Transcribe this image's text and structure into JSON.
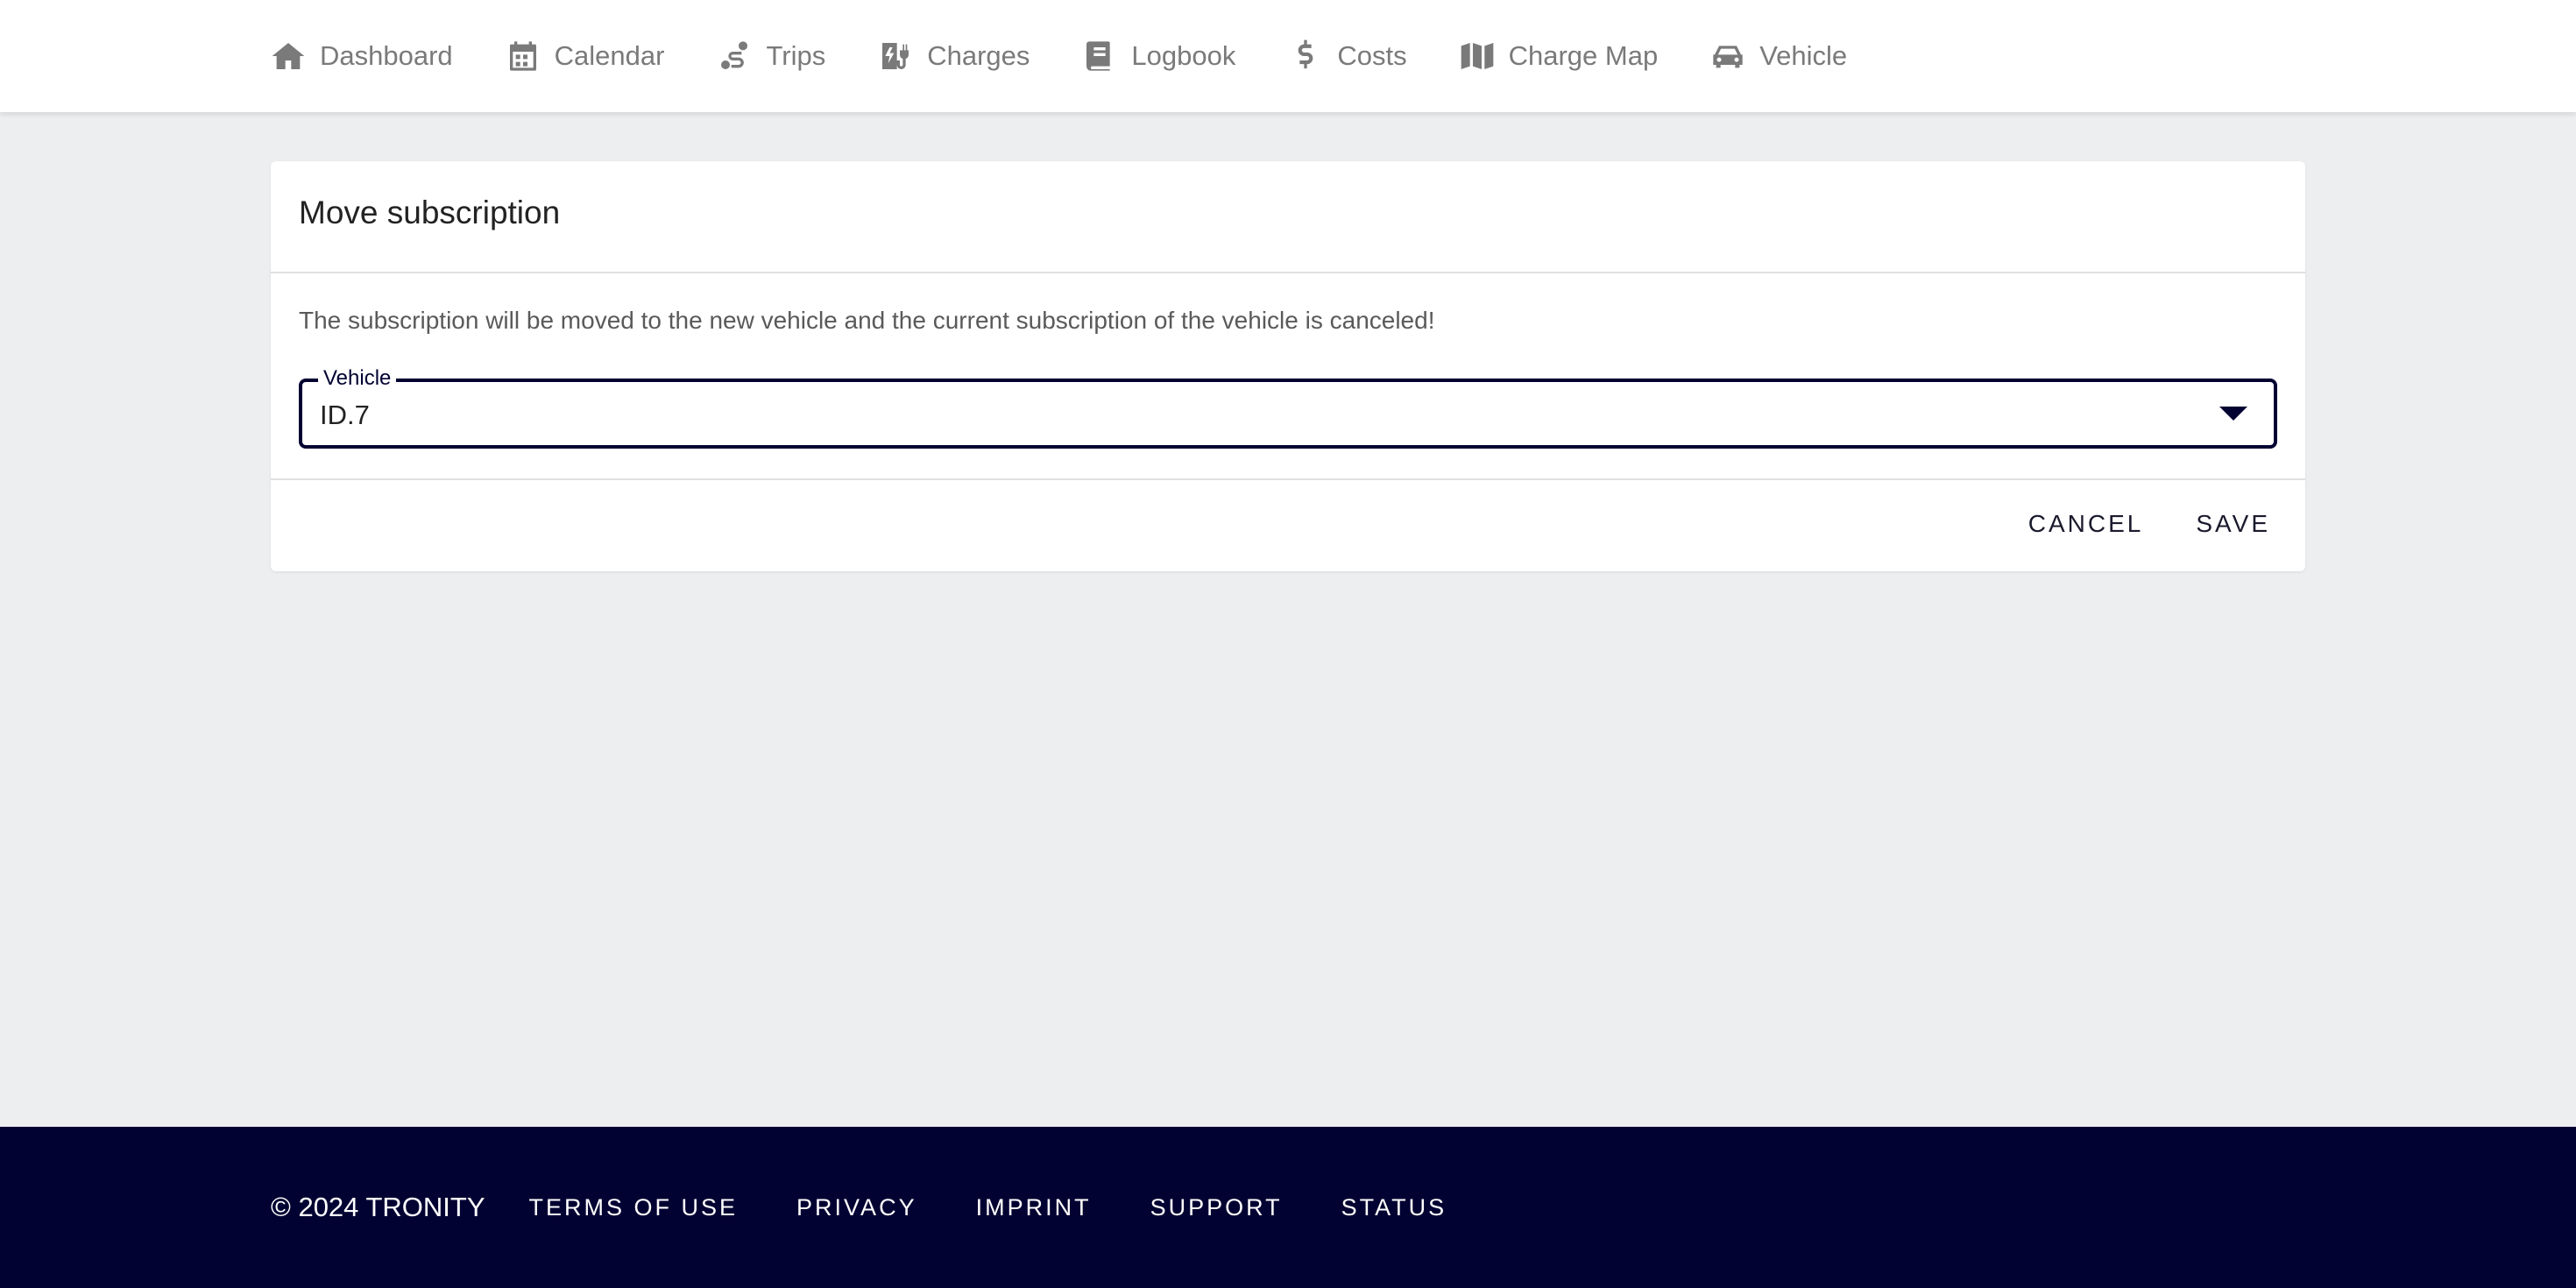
{
  "nav": {
    "items": [
      {
        "label": "Dashboard",
        "icon": "home-icon"
      },
      {
        "label": "Calendar",
        "icon": "calendar-icon"
      },
      {
        "label": "Trips",
        "icon": "route-icon"
      },
      {
        "label": "Charges",
        "icon": "charging-station-icon"
      },
      {
        "label": "Logbook",
        "icon": "book-icon"
      },
      {
        "label": "Costs",
        "icon": "dollar-icon"
      },
      {
        "label": "Charge Map",
        "icon": "map-icon"
      },
      {
        "label": "Vehicle",
        "icon": "car-icon"
      }
    ]
  },
  "dialog": {
    "title": "Move subscription",
    "description": "The subscription will be moved to the new vehicle and the current subscription of the vehicle is canceled!",
    "vehicle_select": {
      "label": "Vehicle",
      "value": "ID.7"
    },
    "cancel_label": "CANCEL",
    "save_label": "SAVE"
  },
  "footer": {
    "copyright": "© 2024 TRONITY",
    "links": [
      "TERMS OF USE",
      "PRIVACY",
      "IMPRINT",
      "SUPPORT",
      "STATUS"
    ]
  },
  "colors": {
    "primary": "#020232",
    "background": "#eceef0",
    "nav_text": "#7a7a7a"
  }
}
